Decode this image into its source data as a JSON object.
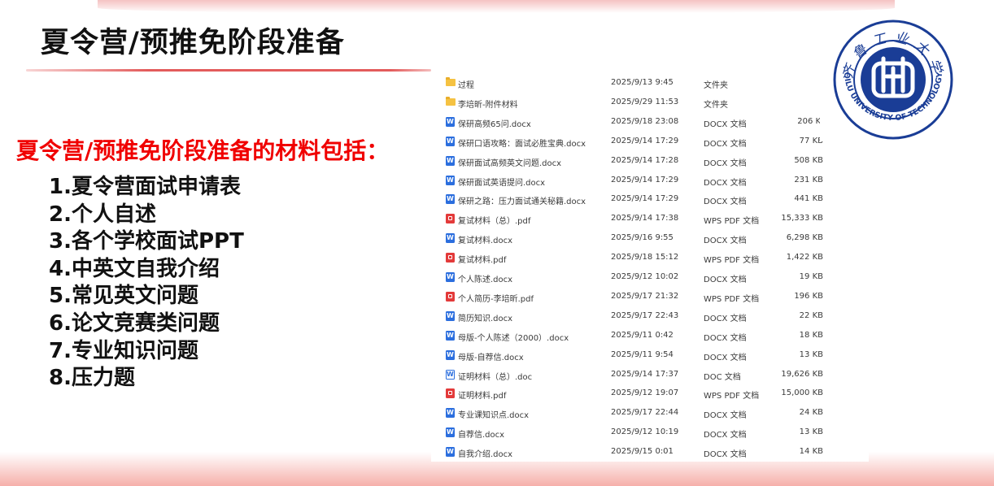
{
  "slide": {
    "title": "夏令营/预推免阶段准备",
    "subtitle": "夏令营/预推免阶段准备的材料包括：",
    "materials": [
      "1.夏令营面试申请表",
      "2.个人自述",
      "3.各个学校面试PPT",
      "4.中英文自我介绍",
      "5.常见英文问题",
      "6.论文竞赛类问题",
      "7.专业知识问题",
      "8.压力题"
    ]
  },
  "logo": {
    "top_text": "齐鲁工业大学",
    "bottom_text": "QILU UNIVERSITY OF TECHNOLOGY",
    "colors": {
      "primary": "#1a3d96"
    }
  },
  "explorer": {
    "files": [
      {
        "name": "过程",
        "date": "2025/9/13 9:45",
        "type": "文件夹",
        "size": "",
        "icon": "folder-icon"
      },
      {
        "name": "李培昕-附件材料",
        "date": "2025/9/29 11:53",
        "type": "文件夹",
        "size": "",
        "icon": "folder-icon"
      },
      {
        "name": "保研高频65问.docx",
        "date": "2025/9/18 23:08",
        "type": "DOCX 文档",
        "size": "206 KI",
        "icon": "docx-icon"
      },
      {
        "name": "保研口语攻略：面试必胜宝典.docx",
        "date": "2025/9/14 17:29",
        "type": "DOCX 文档",
        "size": "77 KB",
        "icon": "docx-icon"
      },
      {
        "name": "保研面试高频英文问题.docx",
        "date": "2025/9/14 17:28",
        "type": "DOCX 文档",
        "size": "508 KB",
        "icon": "docx-icon"
      },
      {
        "name": "保研面试英语提问.docx",
        "date": "2025/9/14 17:29",
        "type": "DOCX 文档",
        "size": "231 KB",
        "icon": "docx-icon"
      },
      {
        "name": "保研之路：压力面试通关秘籍.docx",
        "date": "2025/9/14 17:29",
        "type": "DOCX 文档",
        "size": "441 KB",
        "icon": "docx-icon"
      },
      {
        "name": "复试材料（总）.pdf",
        "date": "2025/9/14 17:38",
        "type": "WPS PDF 文档",
        "size": "15,333 KB",
        "icon": "pdf-icon"
      },
      {
        "name": "复试材料.docx",
        "date": "2025/9/16 9:55",
        "type": "DOCX 文档",
        "size": "6,298 KB",
        "icon": "docx-icon"
      },
      {
        "name": "复试材料.pdf",
        "date": "2025/9/18 15:12",
        "type": "WPS PDF 文档",
        "size": "1,422 KB",
        "icon": "pdf-icon"
      },
      {
        "name": "个人陈述.docx",
        "date": "2025/9/12 10:02",
        "type": "DOCX 文档",
        "size": "19 KB",
        "icon": "docx-icon"
      },
      {
        "name": "个人简历-李培昕.pdf",
        "date": "2025/9/17 21:32",
        "type": "WPS PDF 文档",
        "size": "196 KB",
        "icon": "pdf-icon"
      },
      {
        "name": "简历知识.docx",
        "date": "2025/9/17 22:43",
        "type": "DOCX 文档",
        "size": "22 KB",
        "icon": "docx-icon"
      },
      {
        "name": "母版-个人陈述（2000）.docx",
        "date": "2025/9/11 0:42",
        "type": "DOCX 文档",
        "size": "18 KB",
        "icon": "docx-icon"
      },
      {
        "name": "母版-自荐信.docx",
        "date": "2025/9/11 9:54",
        "type": "DOCX 文档",
        "size": "13 KB",
        "icon": "docx-icon"
      },
      {
        "name": "证明材料（总）.doc",
        "date": "2025/9/14 17:37",
        "type": "DOC 文档",
        "size": "19,626 KB",
        "icon": "doc-icon"
      },
      {
        "name": "证明材料.pdf",
        "date": "2025/9/12 19:07",
        "type": "WPS PDF 文档",
        "size": "15,000 KB",
        "icon": "pdf-icon"
      },
      {
        "name": "专业课知识点.docx",
        "date": "2025/9/17 22:44",
        "type": "DOCX 文档",
        "size": "24 KB",
        "icon": "docx-icon"
      },
      {
        "name": "自荐信.docx",
        "date": "2025/9/12 10:19",
        "type": "DOCX 文档",
        "size": "13 KB",
        "icon": "docx-icon"
      },
      {
        "name": "自我介绍.docx",
        "date": "2025/9/15 0:01",
        "type": "DOCX 文档",
        "size": "14 KB",
        "icon": "docx-icon"
      }
    ]
  }
}
